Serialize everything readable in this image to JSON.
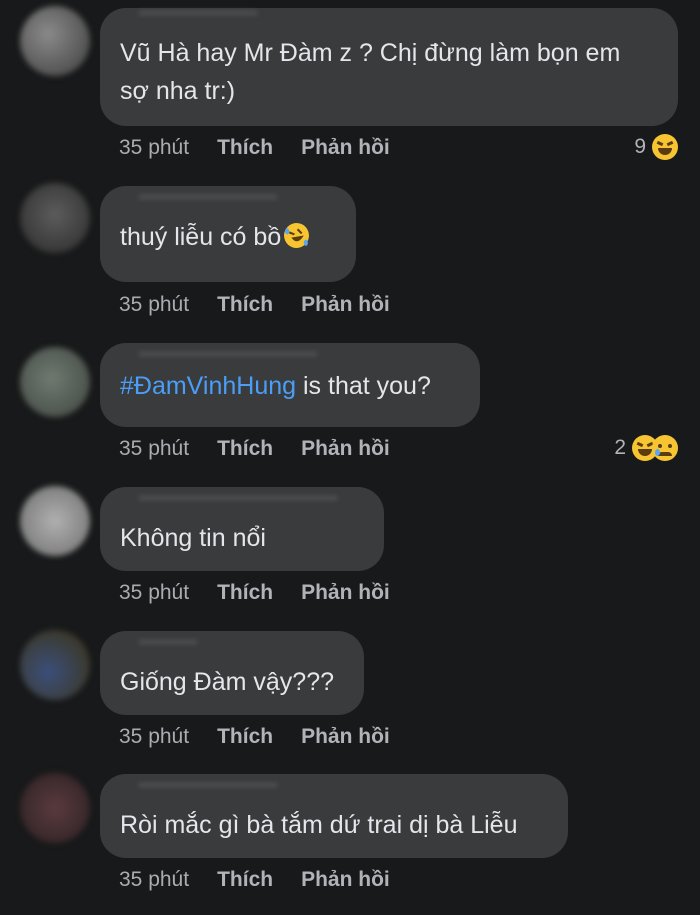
{
  "comments": [
    {
      "text_lines": [
        "Vũ Hà hay Mr Đàm z ? Chị đừng làm bọn em",
        "sợ nha tr:)"
      ],
      "time": "35 phút",
      "like": "Thích",
      "reply": "Phản hồi",
      "reaction_count": "9",
      "reaction_icons": [
        "laughing-emoji"
      ]
    },
    {
      "text_lines": [
        "thuý liễu có bồ"
      ],
      "inline_icon": "rofl-emoji",
      "time": "35 phút",
      "like": "Thích",
      "reply": "Phản hồi"
    },
    {
      "hashtag": "#ĐamVinhHung",
      "text_after_hashtag": " is that you?",
      "time": "35 phút",
      "like": "Thích",
      "reply": "Phản hồi",
      "reaction_count": "2",
      "reaction_icons": [
        "laughing-emoji",
        "sad-emoji"
      ]
    },
    {
      "text_lines": [
        "Không tin nổi"
      ],
      "time": "35 phút",
      "like": "Thích",
      "reply": "Phản hồi"
    },
    {
      "text_lines": [
        "Giống Đàm vậy???"
      ],
      "time": "35 phút",
      "like": "Thích",
      "reply": "Phản hồi"
    },
    {
      "text_lines": [
        "Ròi mắc gì bà tắm dứ trai dị bà Liễu"
      ],
      "time": "35 phút",
      "like": "Thích",
      "reply": "Phản hồi"
    }
  ],
  "colors": {
    "background": "#18191a",
    "bubble": "#3a3b3c",
    "text": "#e4e6eb",
    "meta": "#b0b3b8",
    "hashtag": "#4b9ef7"
  }
}
